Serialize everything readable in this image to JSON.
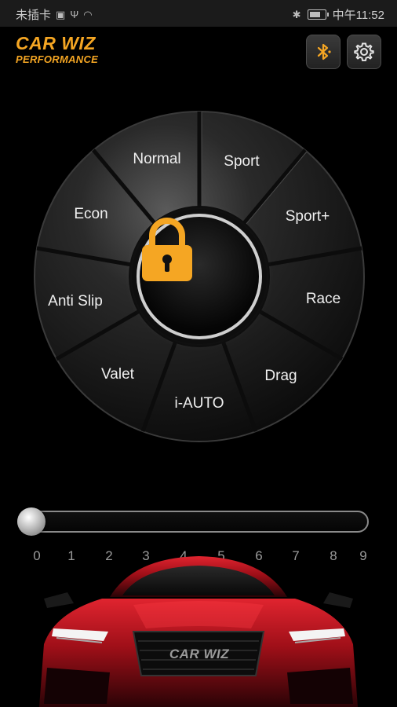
{
  "status_bar": {
    "carrier": "未插卡",
    "time": "中午11:52"
  },
  "header": {
    "logo_line1": "CAR WIZ",
    "logo_line2": "PERFORMANCE",
    "bluetooth_icon": "bluetooth-icon",
    "settings_icon": "gear-icon"
  },
  "dial": {
    "modes": [
      {
        "label": "Normal"
      },
      {
        "label": "Sport"
      },
      {
        "label": "Econ"
      },
      {
        "label": "Sport+"
      },
      {
        "label": "Anti Slip"
      },
      {
        "label": "Race"
      },
      {
        "label": "Valet"
      },
      {
        "label": "Drag"
      },
      {
        "label": "i-AUTO"
      }
    ],
    "center_icon": "lock-icon",
    "accent_color": "#f5a623"
  },
  "slider": {
    "ticks": [
      "0",
      "1",
      "2",
      "3",
      "4",
      "5",
      "6",
      "7",
      "8",
      "9"
    ],
    "value": 0
  },
  "car": {
    "badge": "CAR WIZ",
    "body_color": "#c1121f"
  }
}
